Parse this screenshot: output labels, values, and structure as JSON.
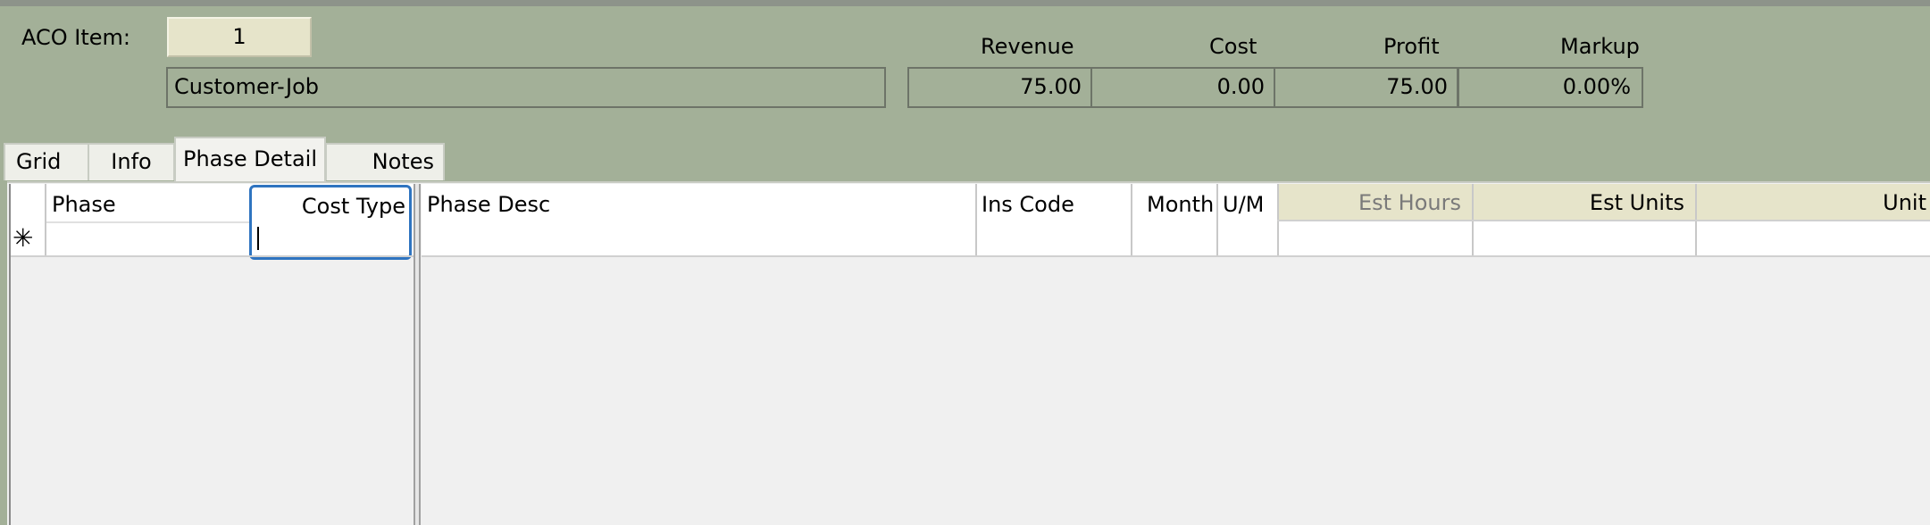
{
  "header": {
    "aco_item_label": "ACO Item:",
    "aco_item_value": "1",
    "description": "Customer-Job",
    "totals": {
      "revenue_label": "Revenue",
      "cost_label": "Cost",
      "profit_label": "Profit",
      "markup_label": "Markup",
      "revenue": "75.00",
      "cost": "0.00",
      "profit": "75.00",
      "markup": "0.00%"
    }
  },
  "tabs": [
    {
      "label": "Grid"
    },
    {
      "label": "Info"
    },
    {
      "label": "Phase Detail",
      "active": true
    },
    {
      "label": "Notes"
    }
  ],
  "grid": {
    "new_row_marker": "✳",
    "left_columns": [
      "Phase",
      "Cost Type"
    ],
    "right_columns": [
      "Phase Desc",
      "Ins Code",
      "Month",
      "U/M",
      "Est Hours",
      "Est Units",
      "Unit"
    ]
  },
  "colors": {
    "background": "#a3b098",
    "highlight_header": "#e6e4ca",
    "focus_border": "#2f74c0"
  }
}
